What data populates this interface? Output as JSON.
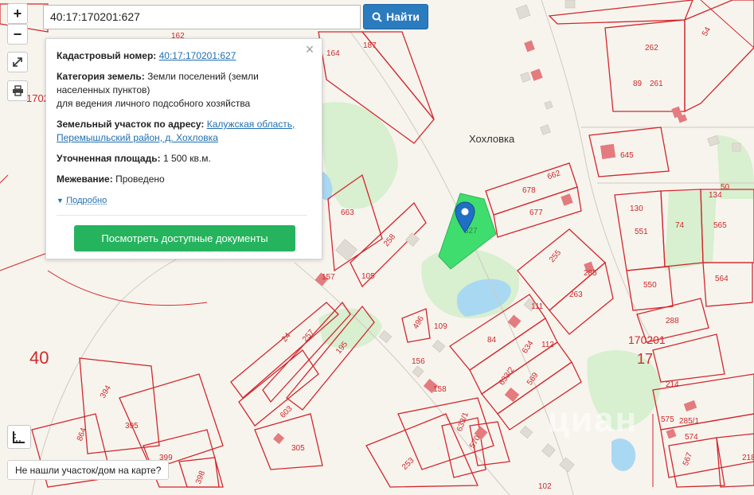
{
  "search": {
    "value": "40:17:170201:627",
    "button_label": "Найти",
    "button_icon": "search-icon"
  },
  "controls": {
    "zoom_in": "+",
    "zoom_out": "−",
    "fullscreen_icon": "expand-icon",
    "print_icon": "printer-icon",
    "ruler_icon": "ruler-icon"
  },
  "card": {
    "cadastral_label": "Кадастровый номер:",
    "cadastral_value": "40:17:170201:627",
    "category_label": "Категория земель:",
    "category_value_1": "Земли поселений (земли",
    "category_value_2": "населенных пунктов)",
    "category_value_3": "для ведения личного подсобного хозяйства",
    "address_label": "Земельный участок по адресу:",
    "address_value_1": "Калужская область,",
    "address_value_2": "Перемышльский район, д. Хохловка",
    "area_label": "Уточненная площадь:",
    "area_value": "1 500 кв.м.",
    "survey_label": "Межевание:",
    "survey_value": "Проведено",
    "more_label": "Подробно",
    "docs_button": "Посмотреть доступные документы",
    "close_icon": "close-icon"
  },
  "map": {
    "village": "Хохловка",
    "quarter_big": "40",
    "quarter_big_right": "17",
    "quarter_right": "170201",
    "selected_plot_label": "627",
    "watermark": "циан",
    "colors": {
      "plot_border": "#d4262b",
      "selected_plot": "#3fdd6e",
      "vegetation": "#d8efd0",
      "water": "#a9d8f3",
      "marker": "#1f6fc4"
    },
    "plot_labels": [
      "162",
      "164",
      "187",
      "262",
      "54",
      "261",
      "89",
      "645",
      "663",
      "678",
      "662",
      "677",
      "134",
      "130",
      "551",
      "74",
      "565",
      "258",
      "255",
      "285",
      "263",
      "550",
      "564",
      "288",
      "105",
      "111",
      "157",
      "24",
      "257",
      "195",
      "496",
      "109",
      "84",
      "634",
      "112",
      "156",
      "633/2",
      "569",
      "214",
      "603",
      "158",
      "633/1",
      "570",
      "575",
      "285/1",
      "574",
      "305",
      "394",
      "395",
      "864",
      "399",
      "253",
      "398",
      "567",
      "218",
      "102",
      "170201",
      "40",
      "17",
      "50"
    ]
  },
  "footer": {
    "not_found": "Не нашли участок/дом на карте?"
  }
}
